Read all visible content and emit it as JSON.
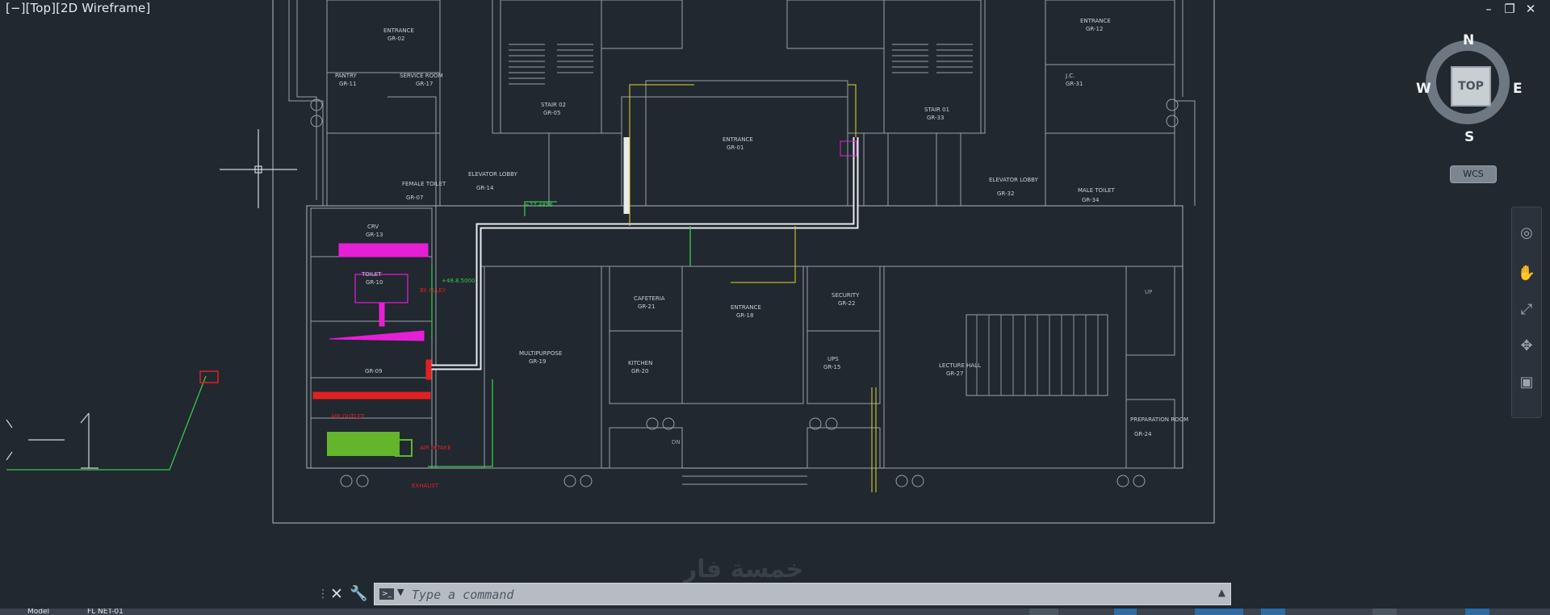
{
  "viewport": {
    "label": "[−][Top][2D Wireframe]"
  },
  "window_controls": {
    "minimize": "–",
    "restore": "❐",
    "close": "✕"
  },
  "viewcube": {
    "face": "TOP",
    "north": "N",
    "south": "S",
    "east": "E",
    "west": "W",
    "ucs": "WCS"
  },
  "commandline": {
    "placeholder": "Type a command"
  },
  "drawing": {
    "rooms": [
      "ENTRANCE",
      "GR-02",
      "ENTRANCE",
      "GR-12",
      "PANTRY",
      "GR-11",
      "SERVICE ROOM",
      "GR-17",
      "J.C.",
      "GR-31",
      "STAIR 02",
      "GR-05",
      "STAIR 01",
      "GR-33",
      "ENTRANCE",
      "GR-01",
      "ELEVATOR LOBBY",
      "GR-14",
      "ELEVATOR LOBBY",
      "GR-32",
      "FEMALE TOILET",
      "GR-07",
      "MALE TOILET",
      "GR-34",
      "CRV",
      "GR-13",
      "TOILET",
      "GR-10",
      "ENTRANCE",
      "GR-18",
      "CAFETERIA",
      "GR-21",
      "SECURITY",
      "GR-22",
      "KITCHEN",
      "GR-20",
      "UPS",
      "GR-15",
      "GR-09",
      "LECTURE HALL",
      "GR-27",
      "PREPARATION ROOM",
      "GR-24",
      "MULTIPURPOSE",
      "GR-19"
    ],
    "labels": {
      "elevation_1": "+77.4856",
      "elevation_2": "+48.8.5000",
      "air_intake": "AIR INTAKE",
      "air_outlet": "AIR OUTLET",
      "exhaust": "EXHAUST",
      "by_alley": "BY ALLEY",
      "up": "UP",
      "dn": "DN"
    }
  },
  "statusbar": {
    "model_tab": "Model",
    "layout_tab": "FL NET-01"
  },
  "watermark": "خمسة فار"
}
